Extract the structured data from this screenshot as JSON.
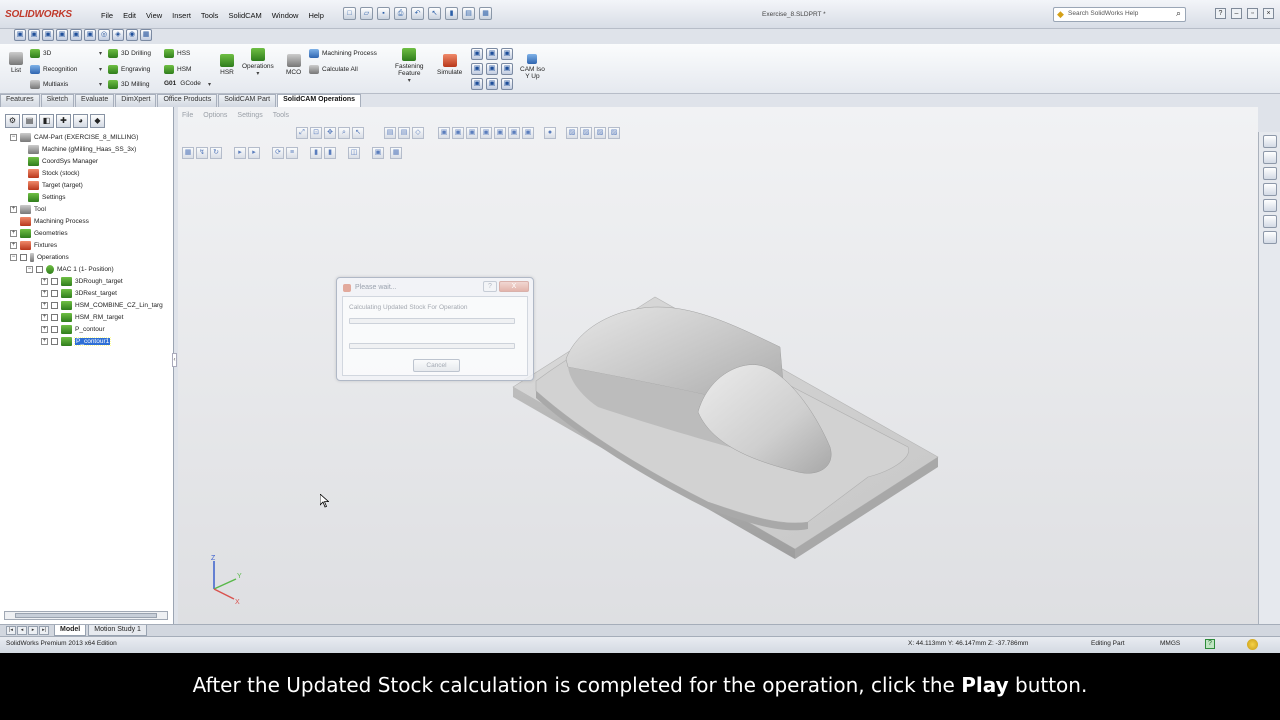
{
  "app": {
    "logo": "SOLIDWORKS",
    "doc_title": "Exercise_8.SLDPRT *"
  },
  "menus": [
    "File",
    "Edit",
    "View",
    "Insert",
    "Tools",
    "SolidCAM",
    "Window",
    "Help"
  ],
  "search": {
    "placeholder": "Search SolidWorks Help"
  },
  "ribbon": {
    "list": "List",
    "c3d": "3D",
    "recognition": "Recognition",
    "multiaxis": "Multiaxis",
    "drilling3d": "3D Drilling",
    "engraving": "Engraving",
    "milling3d": "3D Milling",
    "hss": "HSS",
    "hsm": "HSM",
    "gcode_prefix": "G01",
    "gcode": "GCode",
    "hsr": "HSR",
    "operations": "Operations",
    "mco": "MCO",
    "machining_process": "Machining Process",
    "calculate_all": "Calculate All",
    "fastening_1": "Fastening",
    "fastening_2": "Feature",
    "simulate": "Simulate",
    "cam_iso_1": "CAM Iso",
    "cam_iso_2": "Y Up"
  },
  "tabs": [
    {
      "label": "Features",
      "active": false
    },
    {
      "label": "Sketch",
      "active": false
    },
    {
      "label": "Evaluate",
      "active": false
    },
    {
      "label": "DimXpert",
      "active": false
    },
    {
      "label": "Office Products",
      "active": false
    },
    {
      "label": "SolidCAM Part",
      "active": false
    },
    {
      "label": "SolidCAM Operations",
      "active": true
    }
  ],
  "tree": {
    "cam_part": "CAM-Part (EXERCISE_8_MILLING)",
    "machine": "Machine (gMilling_Haas_SS_3x)",
    "coordsys": "CoordSys Manager",
    "stock": "Stock (stock)",
    "target": "Target (target)",
    "settings": "Settings",
    "tool": "Tool",
    "machining_process": "Machining Process",
    "geometries": "Geometries",
    "fixtures": "Fixtures",
    "operations": "Operations",
    "mac": "MAC 1 (1- Position)",
    "op1": "3DRough_target",
    "op2": "3DRest_target",
    "op3": "HSM_COMBINE_CZ_Lin_targ",
    "op4": "HSM_RM_target",
    "op5": "P_contour",
    "op6": "P_contour1"
  },
  "viewport_menu": [
    "File",
    "Options",
    "Settings",
    "Tools"
  ],
  "dialog": {
    "title": "Please wait...",
    "help": "?",
    "close": "X",
    "message": "Calculating Updated Stock For Operation",
    "cancel": "Cancel",
    "progress_top": 0,
    "progress_bottom": 0
  },
  "triad": {
    "x": "X",
    "y": "Y",
    "z": "Z"
  },
  "bottom_tabs": [
    {
      "label": "Model",
      "active": true
    },
    {
      "label": "Motion Study 1",
      "active": false
    }
  ],
  "status": {
    "edition": "SolidWorks Premium 2013 x64 Edition",
    "coords": "X: 44.113mm Y: 46.147mm Z: -37.786mm",
    "mode": "Editing Part",
    "units": "MMGS",
    "help": "?"
  },
  "caption": {
    "before": "After the Updated Stock calculation is completed for the operation, click the ",
    "bold": "Play",
    "after": " button."
  },
  "colors": {
    "selection": "#2f6fd6",
    "logo": "#c0392b",
    "caption_bg": "#000000"
  }
}
